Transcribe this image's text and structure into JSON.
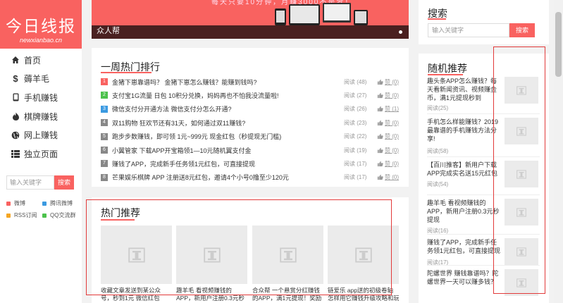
{
  "logo": {
    "title": "今日线报",
    "subtitle": "newxianbao.cn"
  },
  "nav": [
    {
      "label": "首页",
      "icon": "home-icon"
    },
    {
      "label": "薅羊毛",
      "icon": "dollar-icon"
    },
    {
      "label": "手机赚钱",
      "icon": "phone-icon"
    },
    {
      "label": "棋牌赚钱",
      "icon": "fire-icon"
    },
    {
      "label": "网上赚钱",
      "icon": "globe-icon"
    },
    {
      "label": "独立页面",
      "icon": "list-icon"
    }
  ],
  "side_search": {
    "placeholder": "输入关键字",
    "button": "搜索"
  },
  "social": [
    {
      "label": "微博",
      "color": "#f96260"
    },
    {
      "label": "腾讯微博",
      "color": "#3b9ae1"
    },
    {
      "label": "RSS订阅",
      "color": "#f5a623"
    },
    {
      "label": "QQ交流群",
      "color": "#4cc24c"
    }
  ],
  "banner": {
    "top_text": "每天只要10分钟，月赚3000不是梦！",
    "caption": "众人帮"
  },
  "hot_week": {
    "title": "一周热门排行",
    "items": [
      {
        "num": "1",
        "title": "金猪下崽靠谱吗？ 金猪下崽怎么赚钱？能赚到钱吗?",
        "views": "阅读 (48)",
        "likes": "赞 (0)",
        "color": "#f96260"
      },
      {
        "num": "2",
        "title": "支付宝1G流量 日包 10积分兑换，妈妈再也不怕我没流量啦!",
        "views": "阅读 (27)",
        "likes": "赞 (0)",
        "color": "#4cc24c"
      },
      {
        "num": "3",
        "title": "微信支付分开通方法 微信支付分怎么开通?",
        "views": "阅读 (26)",
        "likes": "赞 (1)",
        "color": "#3b9ae1"
      },
      {
        "num": "4",
        "title": "双11购物 狂欢节还有31天，如何通过双11赚钱?",
        "views": "阅读 (23)",
        "likes": "赞 (0)",
        "color": "#888888"
      },
      {
        "num": "5",
        "title": "跑步步数赚钱，即可领 1元~999元 现金红包（秒提现无门槛)",
        "views": "阅读 (22)",
        "likes": "赞 (0)",
        "color": "#888888"
      },
      {
        "num": "6",
        "title": "小翼管家 下载APP开宝箱领1—10元随机翼支付金",
        "views": "阅读 (19)",
        "likes": "赞 (0)",
        "color": "#888888"
      },
      {
        "num": "7",
        "title": "赚钱了APP，完成新手任务领1元红包，可直接提现",
        "views": "阅读 (17)",
        "likes": "赞 (0)",
        "color": "#888888"
      },
      {
        "num": "8",
        "title": "芒果娱乐棋牌 APP 注册送8元红包，邀请4个小号0撸至少120元",
        "views": "阅读 (17)",
        "likes": "赞 (0)",
        "color": "#888888"
      }
    ]
  },
  "hot_rec": {
    "title": "热门推荐",
    "items": [
      {
        "line1": "收藏文章发送到某公众",
        "line2": "号，秒到1元 微信红包"
      },
      {
        "line1": "趣羊毛 看视频赚钱的",
        "line2": "APP，新用户注册0.3元秒"
      },
      {
        "line1": "合众帮 一个悬赏分红赚钱",
        "line2": "的APP，满1元提现！奖励"
      },
      {
        "line1": "链爱乐 app送的初级卷轴",
        "line2": "怎样用它赚钱升级攻略和玩"
      }
    ]
  },
  "right_search": {
    "title": "搜索",
    "placeholder": "输入关键字",
    "button": "搜索"
  },
  "random": {
    "title": "随机推荐",
    "items": [
      {
        "text": "趣头条APP怎么赚钱？每天看新闻资讯、视频赚金币，满1元提现秒到",
        "views": "阅读(25)"
      },
      {
        "text": "手机怎么样能赚钱？2019最靠谱的手机赚钱方法分享!",
        "views": "阅读(58)"
      },
      {
        "text": "【百川推客】新用户下载APP完成实名送15元红包",
        "views": "阅读(54)"
      },
      {
        "text": "趣羊毛 看视频赚钱的APP，新用户注册0.3元秒提现",
        "views": "阅读(16)"
      },
      {
        "text": "赚钱了APP，完成新手任务领1元红包，可直接提现",
        "views": "阅读(17)"
      },
      {
        "text": "陀螺世界 赚钱靠谱吗？陀螺世界一天可以赚多钱？",
        "views": ""
      }
    ]
  }
}
